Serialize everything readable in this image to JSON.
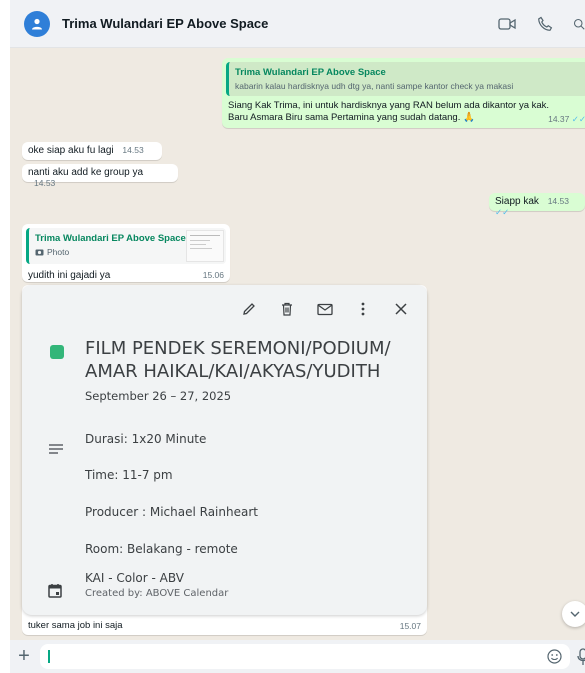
{
  "header": {
    "contact_name": "Trima Wulandari EP Above Space"
  },
  "messages": [
    {
      "direction": "out",
      "quote_name": "Trima Wulandari EP Above Space",
      "quote_text": "kabarin kalau hardisknya udh dtg ya, nanti sampe kantor check ya makasi",
      "text": "Siang Kak Trima, ini untuk hardisknya yang RAN belum ada dikantor ya kak. Baru Asmara Biru sama Pertamina yang sudah datang. 🙏",
      "time": "14.37"
    },
    {
      "direction": "in",
      "text": "oke siap aku fu lagi",
      "time": "14.53"
    },
    {
      "direction": "in",
      "text": "nanti aku add ke group ya",
      "time": "14.53"
    },
    {
      "direction": "out",
      "text": "Siapp kak",
      "time": "14.53"
    },
    {
      "direction": "in",
      "quote_name": "Trima Wulandari EP Above Space",
      "quote_text": "Photo",
      "text": "yudith ini gajadi ya",
      "time": "15.06"
    },
    {
      "direction": "in",
      "text": "tuker sama job ini saja",
      "time": "15.07"
    }
  ],
  "event": {
    "title": "FILM PENDEK SEREMONI/PODIUM/ AMAR HAIKAL/KAI/AKYAS/YUDITH",
    "date": "September 26 – 27, 2025",
    "description": [
      "Durasi: 1x20 Minute",
      "Time: 11-7 pm",
      "Producer : Michael Rainheart",
      "Room: Belakang - remote"
    ],
    "calendar_name": "KAI - Color - ABV",
    "created_by": "Created by: ABOVE Calendar",
    "color": "#33b679"
  },
  "composer": {
    "placeholder": ""
  },
  "colors": {
    "chat_bg": "#efeae2",
    "outgoing": "#d9fdd3",
    "incoming": "#ffffff",
    "accent": "#06a884"
  }
}
